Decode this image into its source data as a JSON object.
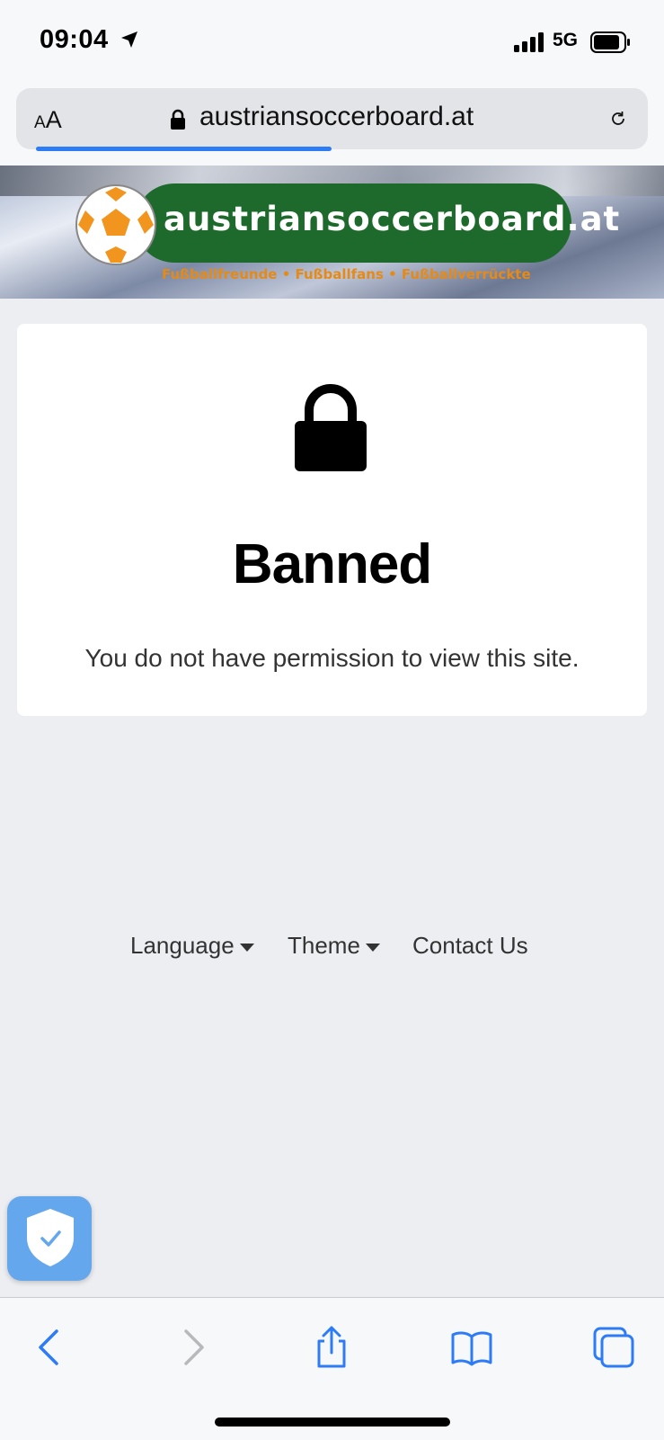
{
  "status_bar": {
    "time": "09:04",
    "network": "5G"
  },
  "browser": {
    "text_size_small": "A",
    "text_size_large": "A",
    "url": "austriansoccerboard.at",
    "load_progress": 0.47
  },
  "banner": {
    "site_name": "austriansoccerboard.at",
    "tagline": "Fußballfreunde • Fußballfans • Fußballverrückte"
  },
  "page": {
    "heading": "Banned",
    "message": "You do not have permission to view this site."
  },
  "footer": {
    "language": "Language",
    "theme": "Theme",
    "contact": "Contact Us"
  },
  "toolbar": {
    "icons": [
      "back-icon",
      "forward-icon",
      "share-icon",
      "bookmarks-icon",
      "tabs-icon"
    ]
  },
  "colors": {
    "accent": "#2d7cf6",
    "banner_green": "#1d6a2c",
    "tagline_orange": "#e68a17",
    "shield_blue": "#64a7ec"
  }
}
